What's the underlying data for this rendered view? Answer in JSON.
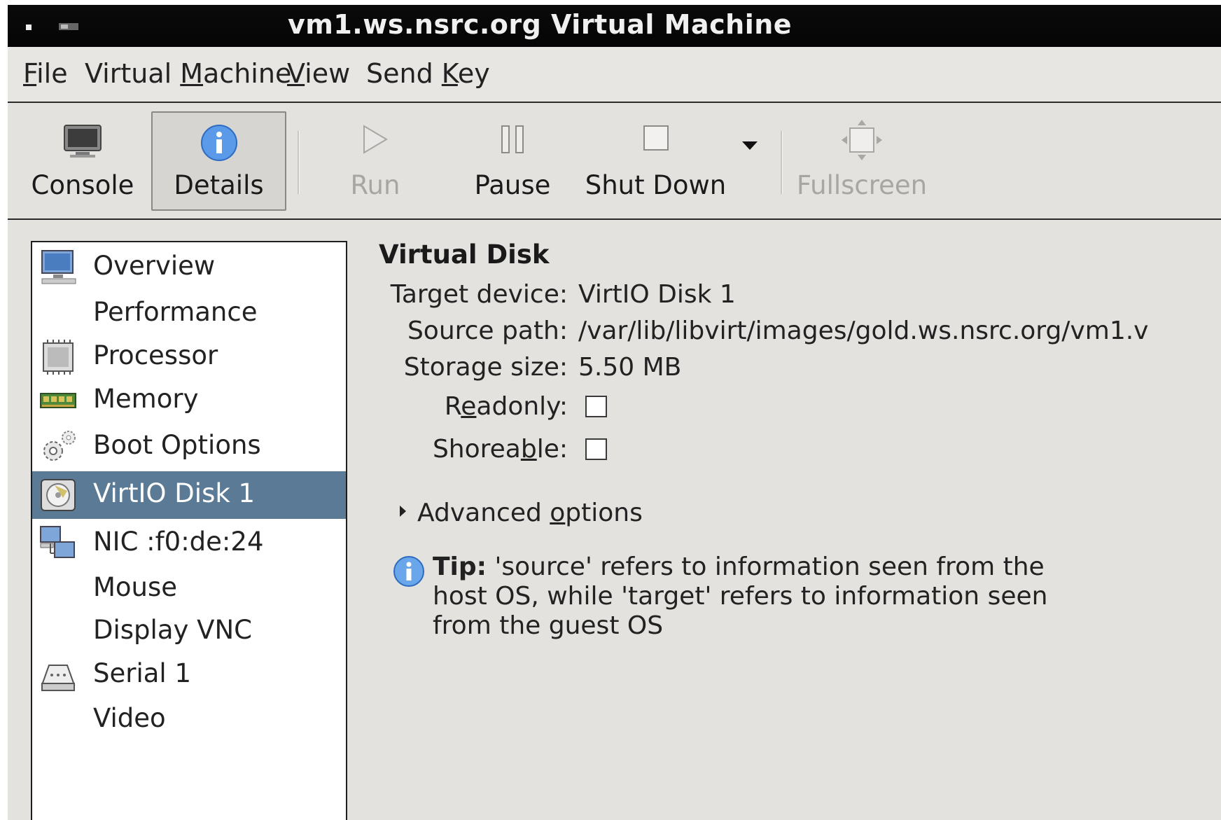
{
  "window": {
    "title": "vm1.ws.nsrc.org Virtual Machine"
  },
  "menubar": {
    "items": [
      {
        "pre": "",
        "mnemonic": "F",
        "post": "ile"
      },
      {
        "pre": "Virtual ",
        "mnemonic": "M",
        "post": "achine"
      },
      {
        "pre": "",
        "mnemonic": "V",
        "post": "iew"
      },
      {
        "pre": "Send ",
        "mnemonic": "K",
        "post": "ey"
      }
    ]
  },
  "toolbar": {
    "console_label": "Console",
    "details_label": "Details",
    "run_label": "Run",
    "pause_label": "Pause",
    "shutdown_label": "Shut Down",
    "fullscreen_label": "Fullscreen"
  },
  "sidebar": {
    "items": [
      {
        "label": "Overview",
        "icon": "monitor-icon"
      },
      {
        "label": "Performance",
        "icon": ""
      },
      {
        "label": "Processor",
        "icon": "cpu-icon"
      },
      {
        "label": "Memory",
        "icon": "memory-icon"
      },
      {
        "label": "Boot Options",
        "icon": "gears-icon"
      },
      {
        "label": "VirtIO Disk 1",
        "icon": "disk-icon",
        "selected": true
      },
      {
        "label": "NIC :f0:de:24",
        "icon": "network-icon"
      },
      {
        "label": "Mouse",
        "icon": ""
      },
      {
        "label": "Display VNC",
        "icon": ""
      },
      {
        "label": "Serial 1",
        "icon": "serial-icon"
      },
      {
        "label": "Video",
        "icon": ""
      }
    ]
  },
  "details": {
    "heading": "Virtual Disk",
    "target_label": "Target device:",
    "target_value": "VirtIO Disk 1",
    "source_label": "Source path:",
    "source_value": "/var/lib/libvirt/images/gold.ws.nsrc.org/vm1.v",
    "storage_label": "Storage size:",
    "storage_value": "5.50 MB",
    "readonly": {
      "pre": "R",
      "mnemonic": "e",
      "post": "adonly:",
      "checked": false
    },
    "shareable": {
      "pre": "Shorea",
      "mnemonic": "b",
      "post": "le:",
      "checked": false
    },
    "advanced": {
      "pre": "Advanced ",
      "mnemonic": "o",
      "post": "ptions"
    },
    "tip_bold": "Tip:",
    "tip_text": " 'source' refers to information seen from the host OS, while 'target' refers to information seen from the guest OS"
  },
  "colors": {
    "selection": "#5b7a96",
    "background": "#e4e2df"
  }
}
